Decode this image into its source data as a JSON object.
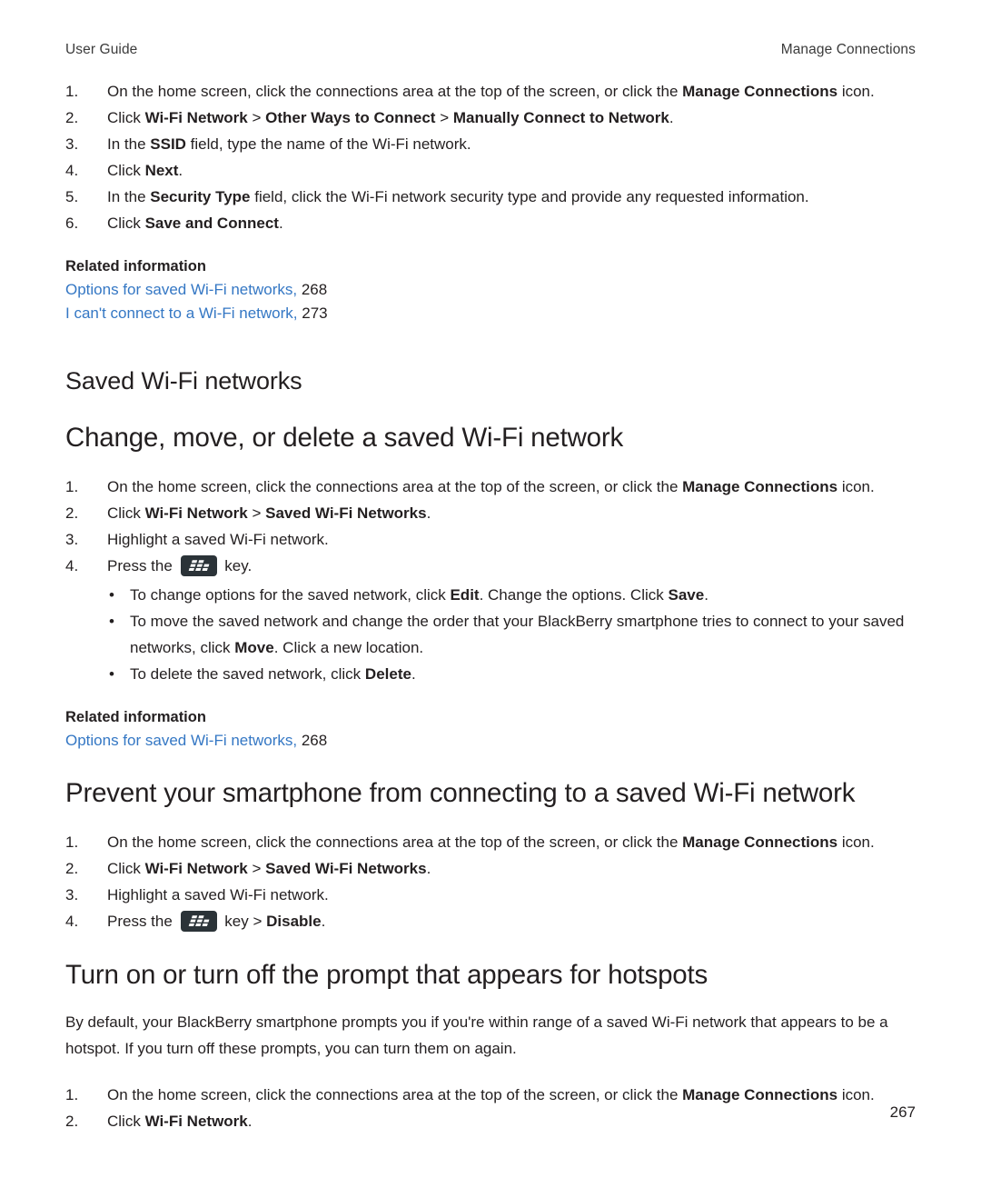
{
  "header": {
    "left": "User Guide",
    "right": "Manage Connections"
  },
  "footer": {
    "page_number": "267"
  },
  "colors": {
    "link": "#3477c4",
    "text": "#231f20",
    "key_icon_bg": "#2b3338"
  },
  "icons": {
    "menu_key": "blackberry-menu-key-icon"
  },
  "section1": {
    "steps": [
      {
        "num": "1.",
        "pre": "On the home screen, click the connections area at the top of the screen, or click the ",
        "bold": "Manage Connections",
        "post": " icon."
      },
      {
        "num": "2.",
        "pre": "Click ",
        "bold": "Wi-Fi Network",
        "sep1": " > ",
        "bold2": "Other Ways to Connect",
        "sep2": " > ",
        "bold3": "Manually Connect to Network",
        "post": "."
      },
      {
        "num": "3.",
        "pre": "In the ",
        "bold": "SSID",
        "post": " field, type the name of the Wi-Fi network."
      },
      {
        "num": "4.",
        "pre": "Click ",
        "bold": "Next",
        "post": "."
      },
      {
        "num": "5.",
        "pre": "In the ",
        "bold": "Security Type",
        "post": " field, click the Wi-Fi network security type and provide any requested information."
      },
      {
        "num": "6.",
        "pre": "Click ",
        "bold": "Save and Connect",
        "post": "."
      }
    ],
    "related": {
      "title": "Related information",
      "links": [
        {
          "text": "Options for saved Wi-Fi networks,",
          "page": "268"
        },
        {
          "text": "I can't connect to a Wi-Fi network,",
          "page": "273"
        }
      ]
    }
  },
  "section2": {
    "heading": "Saved Wi-Fi networks",
    "topic_heading": "Change, move, or delete a saved Wi-Fi network",
    "steps": [
      {
        "num": "1.",
        "pre": "On the home screen, click the connections area at the top of the screen, or click the ",
        "bold": "Manage Connections",
        "post": " icon."
      },
      {
        "num": "2.",
        "pre": "Click ",
        "bold": "Wi-Fi Network",
        "sep1": " > ",
        "bold2": "Saved Wi-Fi Networks",
        "post": "."
      },
      {
        "num": "3.",
        "pre": "Highlight a saved Wi-Fi network.",
        "bold": "",
        "post": ""
      },
      {
        "num": "4.",
        "pre": "Press the ",
        "post": " key."
      }
    ],
    "bullets": [
      {
        "pre": "To change options for the saved network, click ",
        "bold": "Edit",
        "mid": ". Change the options. Click ",
        "bold2": "Save",
        "post": "."
      },
      {
        "pre": "To move the saved network and change the order that your BlackBerry smartphone tries to connect to your saved networks, click ",
        "bold": "Move",
        "mid": ". Click a new location.",
        "bold2": "",
        "post": ""
      },
      {
        "pre": "To delete the saved network, click ",
        "bold": "Delete",
        "mid": ".",
        "bold2": "",
        "post": ""
      }
    ],
    "related": {
      "title": "Related information",
      "links": [
        {
          "text": "Options for saved Wi-Fi networks,",
          "page": "268"
        }
      ]
    }
  },
  "section3": {
    "topic_heading": "Prevent your smartphone from connecting to a saved Wi-Fi network",
    "steps": [
      {
        "num": "1.",
        "pre": "On the home screen, click the connections area at the top of the screen, or click the ",
        "bold": "Manage Connections",
        "post": " icon."
      },
      {
        "num": "2.",
        "pre": "Click ",
        "bold": "Wi-Fi Network",
        "sep1": " > ",
        "bold2": "Saved Wi-Fi Networks",
        "post": "."
      },
      {
        "num": "3.",
        "pre": "Highlight a saved Wi-Fi network.",
        "bold": "",
        "post": ""
      },
      {
        "num": "4.",
        "pre": "Press the ",
        "mid": " key > ",
        "bold": "Disable",
        "post": "."
      }
    ]
  },
  "section4": {
    "topic_heading": "Turn on or turn off the prompt that appears for hotspots",
    "paragraph": "By default, your BlackBerry smartphone prompts you if you're within range of a saved Wi-Fi network that appears to be a hotspot. If you turn off these prompts, you can turn them on again.",
    "steps": [
      {
        "num": "1.",
        "pre": "On the home screen, click the connections area at the top of the screen, or click the ",
        "bold": "Manage Connections",
        "post": " icon."
      },
      {
        "num": "2.",
        "pre": "Click ",
        "bold": "Wi-Fi Network",
        "post": "."
      }
    ]
  }
}
